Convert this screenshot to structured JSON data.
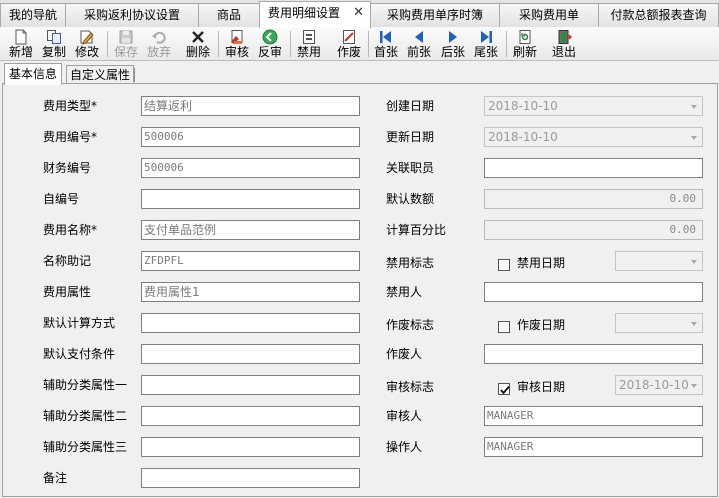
{
  "doc_tabs": [
    {
      "label": "我的导航"
    },
    {
      "label": "采购返利协议设置"
    },
    {
      "label": "商品"
    },
    {
      "label": "费用明细设置",
      "active": true
    },
    {
      "label": "采购费用单序时簿"
    },
    {
      "label": "采购费用单"
    },
    {
      "label": "付款总额报表查询"
    }
  ],
  "toolbar": {
    "buttons": [
      {
        "label": "新增",
        "icon": "new-doc-icon"
      },
      {
        "label": "复制",
        "icon": "copy-icon"
      },
      {
        "label": "修改",
        "icon": "edit-icon"
      },
      {
        "label": "保存",
        "icon": "save-icon",
        "disabled": true
      },
      {
        "label": "放弃",
        "icon": "undo-icon",
        "disabled": true
      },
      {
        "label": "删除",
        "icon": "delete-icon"
      },
      {
        "label": "审核",
        "icon": "audit-icon"
      },
      {
        "label": "反审",
        "icon": "unaudit-icon"
      },
      {
        "label": "禁用",
        "icon": "disable-icon"
      },
      {
        "label": "作废",
        "icon": "void-icon"
      },
      {
        "label": "首张",
        "icon": "first-icon"
      },
      {
        "label": "前张",
        "icon": "prev-icon"
      },
      {
        "label": "后张",
        "icon": "next-icon"
      },
      {
        "label": "尾张",
        "icon": "last-icon"
      },
      {
        "label": "刷新",
        "icon": "refresh-icon"
      },
      {
        "label": "退出",
        "icon": "exit-icon"
      }
    ]
  },
  "section_tabs": [
    {
      "label": "基本信息",
      "active": true
    },
    {
      "label": "自定义属性"
    }
  ],
  "form": {
    "fee_type": {
      "label": "费用类型*",
      "value": "结算返利"
    },
    "fee_code": {
      "label": "费用编号*",
      "value": "500006"
    },
    "finance_code": {
      "label": "财务编号",
      "value": "500006"
    },
    "self_code": {
      "label": "自编号",
      "value": ""
    },
    "fee_name": {
      "label": "费用名称*",
      "value": "支付单品范例"
    },
    "name_mnemonic": {
      "label": "名称助记",
      "value": "ZFDPFL"
    },
    "fee_attr": {
      "label": "费用属性",
      "value": "费用属性1"
    },
    "default_calc": {
      "label": "默认计算方式",
      "value": ""
    },
    "default_pay": {
      "label": "默认支付条件",
      "value": ""
    },
    "aux_attr1": {
      "label": "辅助分类属性一",
      "value": ""
    },
    "aux_attr2": {
      "label": "辅助分类属性二",
      "value": ""
    },
    "aux_attr3": {
      "label": "辅助分类属性三",
      "value": ""
    },
    "remark": {
      "label": "备注",
      "value": ""
    },
    "create_date": {
      "label": "创建日期",
      "value": "2018-10-10"
    },
    "update_date": {
      "label": "更新日期",
      "value": "2018-10-10"
    },
    "related_staff": {
      "label": "关联职员",
      "value": ""
    },
    "default_amount": {
      "label": "默认数额",
      "value": "0.00"
    },
    "calc_percent": {
      "label": "计算百分比",
      "value": "0.00"
    },
    "disable_flag": {
      "label": "禁用标志",
      "checked": false
    },
    "disable_date": {
      "label": "禁用日期",
      "value": ""
    },
    "disabled_by": {
      "label": "禁用人",
      "value": ""
    },
    "void_flag": {
      "label": "作废标志",
      "checked": false
    },
    "void_date": {
      "label": "作废日期",
      "value": ""
    },
    "voided_by": {
      "label": "作废人",
      "value": ""
    },
    "audit_flag": {
      "label": "审核标志",
      "checked": true
    },
    "audit_date": {
      "label": "审核日期",
      "value": "2018-10-10"
    },
    "auditor": {
      "label": "审核人",
      "value": "MANAGER"
    },
    "operator": {
      "label": "操作人",
      "value": "MANAGER"
    }
  }
}
